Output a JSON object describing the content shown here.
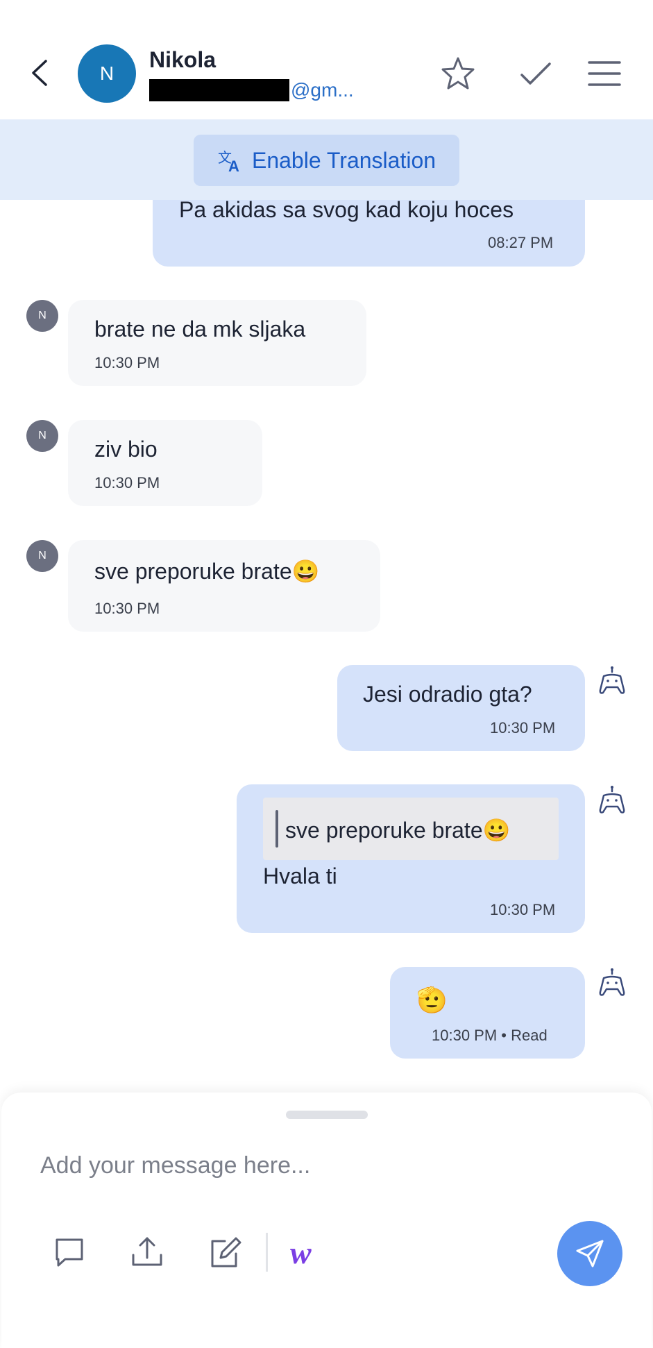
{
  "header": {
    "avatar_initial": "N",
    "contact_name": "Nikola",
    "email_visible": "@gm...",
    "accent": "#1877b6"
  },
  "translation": {
    "label": "Enable Translation"
  },
  "messages": [
    {
      "direction": "outgoing",
      "text": "Pa akidas sa svog kad koju hoces",
      "time": "08:27 PM"
    },
    {
      "direction": "incoming",
      "avatar": "N",
      "text": "brate ne da mk sljaka",
      "time": "10:30 PM"
    },
    {
      "direction": "incoming",
      "avatar": "N",
      "text": "ziv bio",
      "time": "10:30 PM"
    },
    {
      "direction": "incoming",
      "avatar": "N",
      "text": "sve preporuke brate😀",
      "time": "10:30 PM"
    },
    {
      "direction": "outgoing",
      "text": "Jesi odradio gta?",
      "time": "10:30 PM"
    },
    {
      "direction": "outgoing",
      "quote": "sve preporuke brate😀",
      "text": "Hvala ti",
      "time": "10:30 PM"
    },
    {
      "direction": "outgoing",
      "text": "🫡",
      "time": "10:30 PM • Read"
    }
  ],
  "composer": {
    "placeholder": "Add your message here...",
    "toolbar_icons": [
      "comment-icon",
      "upload-icon",
      "edit-icon",
      "w-app-icon"
    ],
    "w_label": "w",
    "send_color": "#5b93f0"
  }
}
